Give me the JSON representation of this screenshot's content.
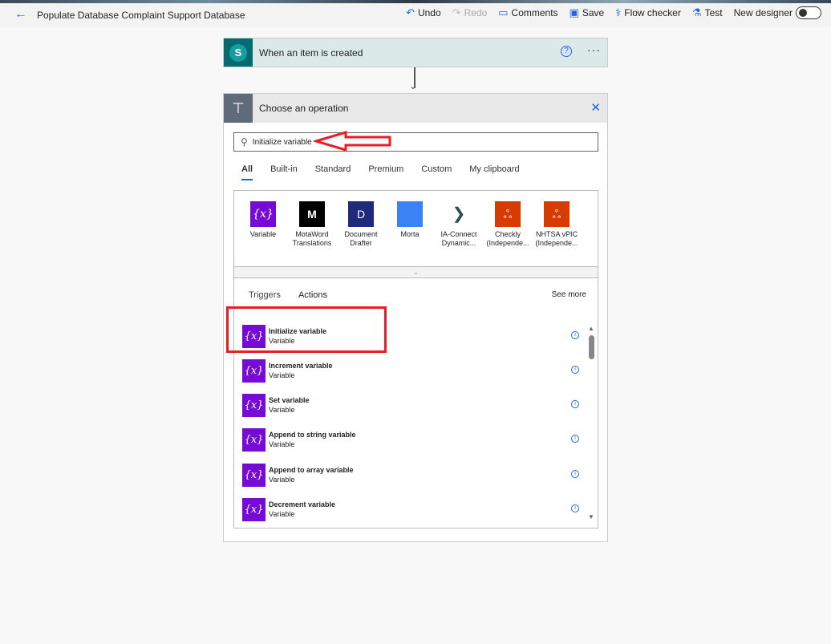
{
  "header": {
    "title": "Populate Database Complaint Support Database",
    "tools": [
      {
        "label": "Undo",
        "icon": "undo-icon"
      },
      {
        "label": "Redo",
        "icon": "redo-icon",
        "disabled": true
      },
      {
        "label": "Comments",
        "icon": "comment-icon"
      },
      {
        "label": "Save",
        "icon": "save-icon"
      },
      {
        "label": "Flow checker",
        "icon": "stethoscope-icon"
      },
      {
        "label": "Test",
        "icon": "flask-icon"
      }
    ],
    "new_designer": "New designer",
    "new_designer_on": false
  },
  "trigger": {
    "title": "When an item is created",
    "icon": "sharepoint-icon"
  },
  "operation": {
    "title": "Choose an operation",
    "search_value": "Initialize variable",
    "tabs": [
      "All",
      "Built-in",
      "Standard",
      "Premium",
      "Custom",
      "My clipboard"
    ],
    "active_tab": "All",
    "connectors": [
      {
        "name": "Variable",
        "color": "#770bd6"
      },
      {
        "name": "MotaWord Translations",
        "color": "#000000"
      },
      {
        "name": "Document Drafter",
        "color": "#1f2a7a"
      },
      {
        "name": "Morta",
        "color": "#3b82f6"
      },
      {
        "name": "IA-Connect Dynamic...",
        "color": "#ffffff"
      },
      {
        "name": "Checkly (Independe...",
        "color": "#d83b01"
      },
      {
        "name": "NHTSA vPIC (Independe...",
        "color": "#d83b01"
      }
    ],
    "subtabs": [
      "Triggers",
      "Actions"
    ],
    "see_more": "See more",
    "actions": [
      {
        "title": "Initialize variable",
        "sub": "Variable"
      },
      {
        "title": "Increment variable",
        "sub": "Variable"
      },
      {
        "title": "Set variable",
        "sub": "Variable"
      },
      {
        "title": "Append to string variable",
        "sub": "Variable"
      },
      {
        "title": "Append to array variable",
        "sub": "Variable"
      },
      {
        "title": "Decrement variable",
        "sub": "Variable"
      }
    ]
  },
  "colors": {
    "accent": "#2266e3",
    "variable": "#770bd6",
    "annotation": "#e81d25"
  }
}
